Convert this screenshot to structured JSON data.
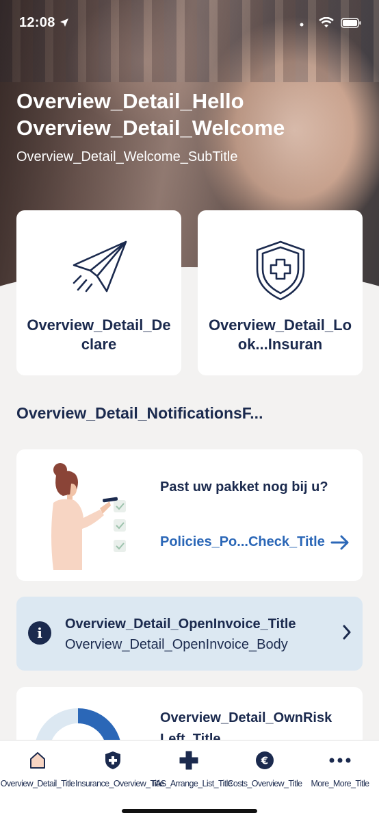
{
  "status_bar": {
    "time": "12:08"
  },
  "hero": {
    "hello": "Overview_Detail_Hello",
    "welcome": "Overview_Detail_Welcome",
    "subtitle": "Overview_Detail_Welcome_SubTitle"
  },
  "tiles": [
    {
      "label": "Overview_Detail_Declare",
      "icon": "paper-plane-icon"
    },
    {
      "label": "Overview_Detail_Look...Insuran",
      "icon": "shield-plus-icon"
    }
  ],
  "notifications": {
    "section_title": "Overview_Detail_NotificationsF...",
    "package_check": {
      "question": "Past uw pakket nog bij u?",
      "link": "Policies_Po...Check_Title"
    },
    "open_invoice": {
      "title": "Overview_Detail_OpenInvoice_Title",
      "body": "Overview_Detail_OpenInvoice_Body"
    },
    "own_risk": {
      "title": "Overview_Detail_OwnRisk Left_Title"
    }
  },
  "tabbar": {
    "tabs": [
      {
        "label": "Overview_Detail_Title",
        "icon": "home-icon"
      },
      {
        "label": "Insurance_Overview_Title",
        "icon": "shield-plus-icon"
      },
      {
        "label": "TAS_Arrange_List_Title",
        "icon": "plus-icon"
      },
      {
        "label": "Costs_Overview_Title",
        "icon": "euro-icon"
      },
      {
        "label": "More_More_Title",
        "icon": "more-icon"
      }
    ]
  },
  "colors": {
    "navy": "#1b2a4e",
    "accent_blue": "#2b67b7",
    "info_bg": "#dce8f2",
    "background": "#f3f2f1"
  }
}
